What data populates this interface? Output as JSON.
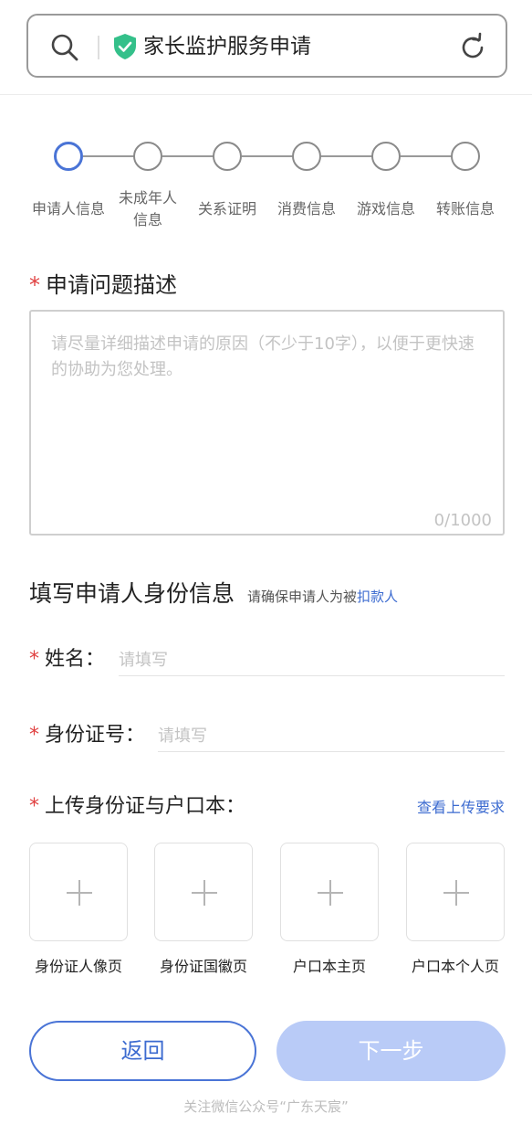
{
  "browser": {
    "title": "家长监护服务申请"
  },
  "steps": [
    {
      "label": "申请人信息",
      "active": true
    },
    {
      "label": "未成年人\n信息",
      "active": false
    },
    {
      "label": "关系证明",
      "active": false
    },
    {
      "label": "消费信息",
      "active": false
    },
    {
      "label": "游戏信息",
      "active": false
    },
    {
      "label": "转账信息",
      "active": false
    }
  ],
  "problem": {
    "required_mark": "*",
    "title": "申请问题描述",
    "placeholder": "请尽量详细描述申请的原因（不少于10字），以便于更快速的协助为您处理。",
    "counter": "0/1000"
  },
  "identity": {
    "heading": "填写申请人身份信息",
    "hint": "请确保申请人为被",
    "hint_link": "扣款人",
    "name_label": "姓名：",
    "name_placeholder": "请填写",
    "id_label": "身份证号：",
    "id_placeholder": "请填写",
    "upload_label": "上传身份证与户口本：",
    "view_requirements": "查看上传要求",
    "uploads": [
      "身份证人像页",
      "身份证国徽页",
      "户口本主页",
      "户口本个人页"
    ]
  },
  "actions": {
    "back": "返回",
    "next": "下一步"
  },
  "footer": "关注微信公众号“广东天宸”",
  "colors": {
    "accent": "#4a74d6",
    "link": "#3c6bd0",
    "required": "#e04040",
    "next_disabled": "#b9cbf7"
  }
}
